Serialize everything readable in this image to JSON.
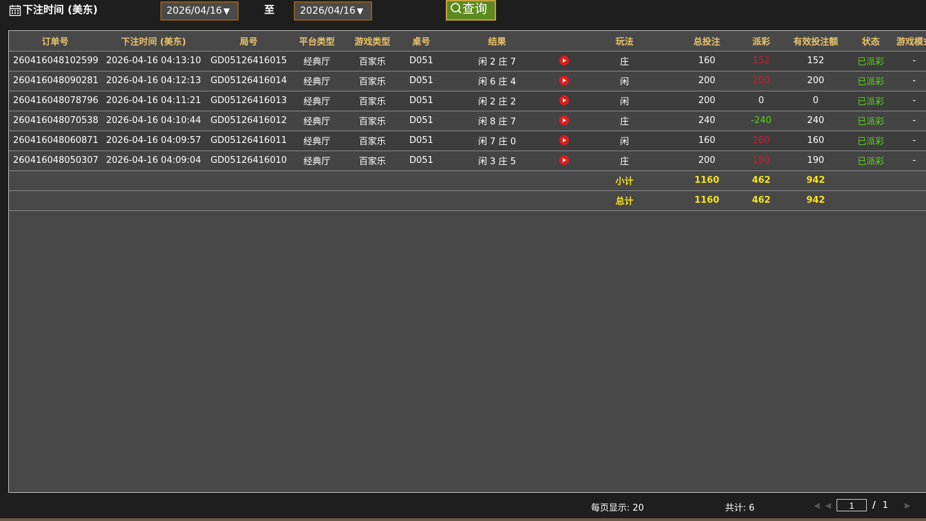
{
  "filter": {
    "label": "下注时间 (美东)",
    "date_from": "2026/04/16",
    "to_label": "至",
    "date_to": "2026/04/16",
    "query_label": "查询",
    "arrow": "▼"
  },
  "table": {
    "headers": [
      "订单号",
      "下注时间 (美东)",
      "局号",
      "平台类型",
      "游戏类型",
      "桌号",
      "结果",
      "",
      "玩法",
      "总投注",
      "派彩",
      "有效投注额",
      "状态",
      "游戏模式"
    ],
    "rows": [
      {
        "order": "260416048102599",
        "time": "2026-04-16 04:13:10",
        "round": "GD05126416015",
        "platform": "经典厅",
        "game": "百家乐",
        "table": "D051",
        "result": "闲 2 庄 7",
        "bet": "庄",
        "total": "160",
        "payout": "152",
        "payout_class": "neg-red",
        "valid": "152",
        "status": "已派彩",
        "mode": "-"
      },
      {
        "order": "260416048090281",
        "time": "2026-04-16 04:12:13",
        "round": "GD05126416014",
        "platform": "经典厅",
        "game": "百家乐",
        "table": "D051",
        "result": "闲 6 庄 4",
        "bet": "闲",
        "total": "200",
        "payout": "200",
        "payout_class": "neg-red",
        "valid": "200",
        "status": "已派彩",
        "mode": "-"
      },
      {
        "order": "260416048078796",
        "time": "2026-04-16 04:11:21",
        "round": "GD05126416013",
        "platform": "经典厅",
        "game": "百家乐",
        "table": "D051",
        "result": "闲 2 庄 2",
        "bet": "闲",
        "total": "200",
        "payout": "0",
        "payout_class": "",
        "valid": "0",
        "status": "已派彩",
        "mode": "-"
      },
      {
        "order": "260416048070538",
        "time": "2026-04-16 04:10:44",
        "round": "GD05126416012",
        "platform": "经典厅",
        "game": "百家乐",
        "table": "D051",
        "result": "闲 8 庄 7",
        "bet": "庄",
        "total": "240",
        "payout": "-240",
        "payout_class": "neg-green",
        "valid": "240",
        "status": "已派彩",
        "mode": "-"
      },
      {
        "order": "260416048060871",
        "time": "2026-04-16 04:09:57",
        "round": "GD05126416011",
        "platform": "经典厅",
        "game": "百家乐",
        "table": "D051",
        "result": "闲 7 庄 0",
        "bet": "闲",
        "total": "160",
        "payout": "160",
        "payout_class": "neg-red",
        "valid": "160",
        "status": "已派彩",
        "mode": "-"
      },
      {
        "order": "260416048050307",
        "time": "2026-04-16 04:09:04",
        "round": "GD05126416010",
        "platform": "经典厅",
        "game": "百家乐",
        "table": "D051",
        "result": "闲 3 庄 5",
        "bet": "庄",
        "total": "200",
        "payout": "190",
        "payout_class": "neg-red",
        "valid": "190",
        "status": "已派彩",
        "mode": "-"
      }
    ],
    "subtotal": {
      "label": "小计",
      "total": "1160",
      "payout": "462",
      "valid": "942"
    },
    "grandtotal": {
      "label": "总计",
      "total": "1160",
      "payout": "462",
      "valid": "942"
    }
  },
  "footer": {
    "per_page": "每页显示: 20",
    "total": "共计: 6",
    "current_page": "1",
    "page_sep": "/",
    "total_pages": "1"
  },
  "colors": {
    "header_text": "#e9c36a",
    "sum_text": "#f5e21d",
    "status_green": "#5ad11e",
    "payout_red": "#c81e32",
    "query_btn": "#5c8a1f"
  }
}
